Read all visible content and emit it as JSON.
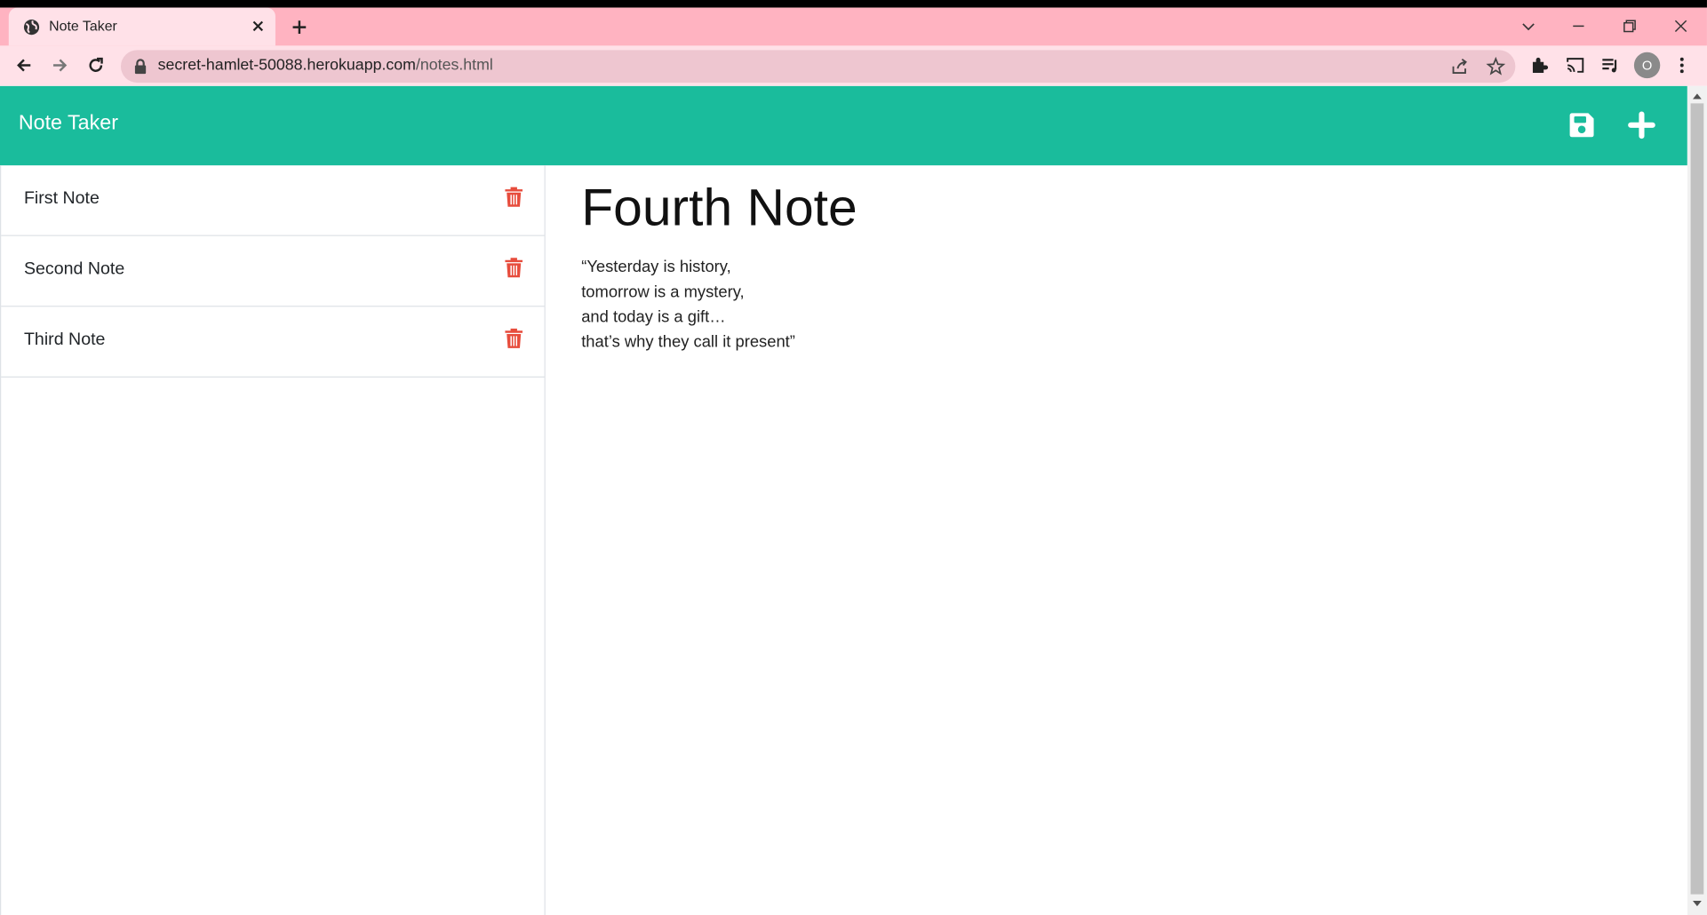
{
  "browser": {
    "tab_title": "Note Taker",
    "url_host": "secret-hamlet-50088.herokuapp.com",
    "url_path": "/notes.html",
    "avatar_initial": "O",
    "colors": {
      "tabstrip": "#ffb3c1",
      "toolbar": "#ffe1e8"
    }
  },
  "app": {
    "brand": "Note Taker",
    "accent_color": "#1abc9c",
    "delete_color": "#e74c3c",
    "actions": {
      "save_icon": "save-icon",
      "new_icon": "plus-icon"
    }
  },
  "sidebar": {
    "notes": [
      {
        "title": "First Note"
      },
      {
        "title": "Second Note"
      },
      {
        "title": "Third Note"
      }
    ]
  },
  "main": {
    "note_title": "Fourth Note",
    "note_text": "“Yesterday is history,\ntomorrow is a mystery,\nand today is a gift…\nthat’s why they call it present”"
  }
}
